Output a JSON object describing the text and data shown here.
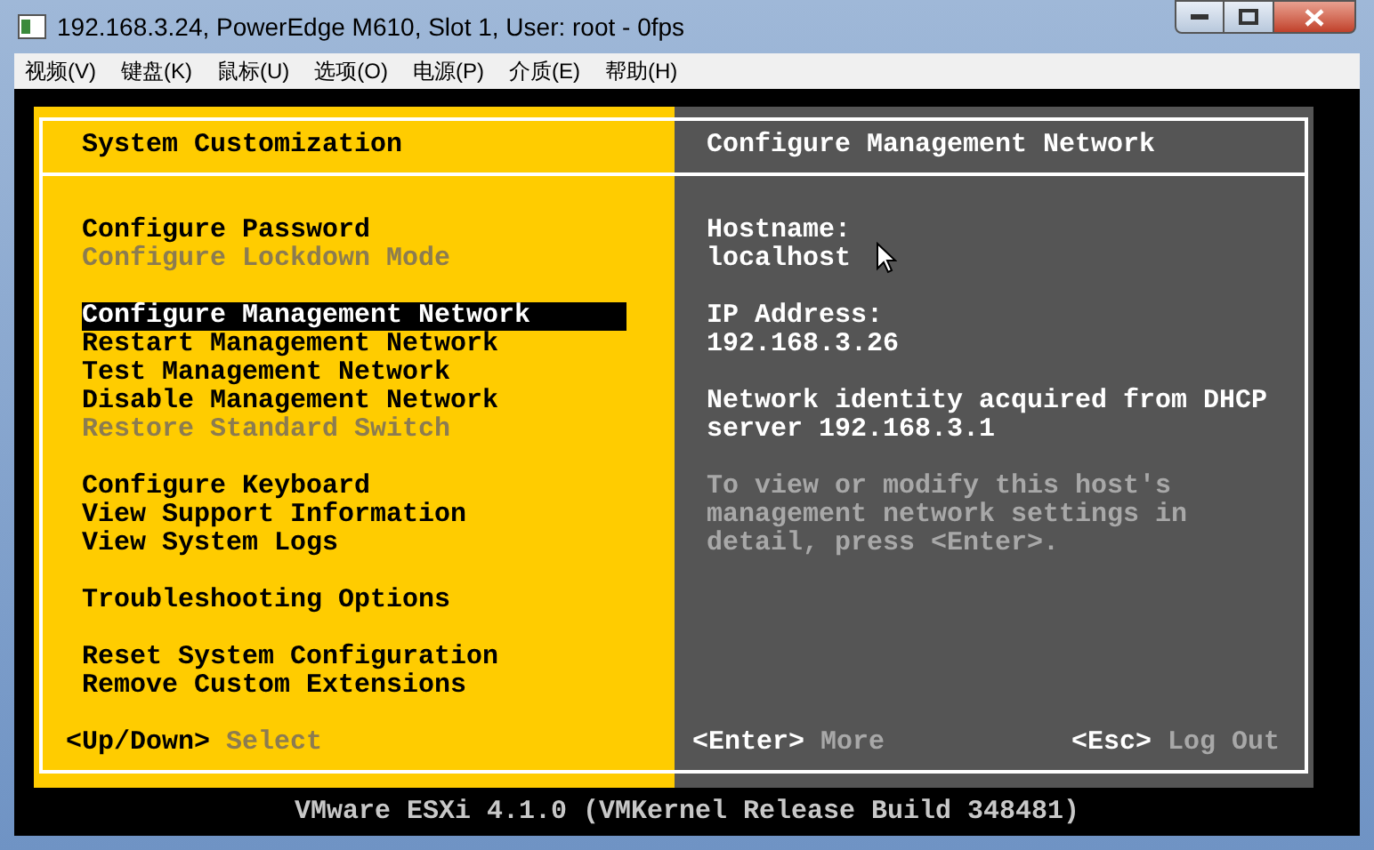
{
  "window": {
    "title": "192.168.3.24, PowerEdge M610, Slot 1, User: root - 0fps"
  },
  "menu": [
    "视频(V)",
    "键盘(K)",
    "鼠标(U)",
    "选项(O)",
    "电源(P)",
    "介质(E)",
    "帮助(H)"
  ],
  "left_panel": {
    "title": "System Customization",
    "groups": [
      [
        {
          "label": "Configure Password",
          "selected": false,
          "disabled": false
        },
        {
          "label": "Configure Lockdown Mode",
          "selected": false,
          "disabled": true
        }
      ],
      [
        {
          "label": "Configure Management Network",
          "selected": true,
          "disabled": false
        },
        {
          "label": "Restart Management Network",
          "selected": false,
          "disabled": false
        },
        {
          "label": "Test Management Network",
          "selected": false,
          "disabled": false
        },
        {
          "label": "Disable Management Network",
          "selected": false,
          "disabled": false
        },
        {
          "label": "Restore Standard Switch",
          "selected": false,
          "disabled": true
        }
      ],
      [
        {
          "label": "Configure Keyboard",
          "selected": false,
          "disabled": false
        },
        {
          "label": "View Support Information",
          "selected": false,
          "disabled": false
        },
        {
          "label": "View System Logs",
          "selected": false,
          "disabled": false
        }
      ],
      [
        {
          "label": "Troubleshooting Options",
          "selected": false,
          "disabled": false
        }
      ],
      [
        {
          "label": "Reset System Configuration",
          "selected": false,
          "disabled": false
        },
        {
          "label": "Remove Custom Extensions",
          "selected": false,
          "disabled": false
        }
      ]
    ],
    "footer": [
      {
        "key": "<Up/Down>",
        "action": "Select"
      }
    ]
  },
  "right_panel": {
    "title": "Configure Management Network",
    "fields": [
      {
        "label": "Hostname:",
        "value": "localhost"
      },
      {
        "label": "IP Address:",
        "value": "192.168.3.26"
      }
    ],
    "info": "Network identity acquired from DHCP server 192.168.3.1",
    "hint": "To view or modify this host's management network settings in detail, press <Enter>.",
    "footer": [
      {
        "key": "<Enter>",
        "action": "More"
      },
      {
        "key": "<Esc>",
        "action": "Log Out"
      }
    ]
  },
  "status_line": "VMware ESXi 4.1.0 (VMKernel Release Build 348481)"
}
